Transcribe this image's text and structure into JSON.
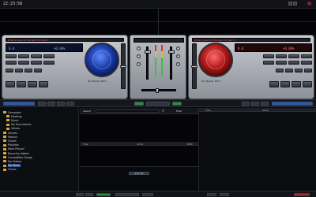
{
  "topbar": {
    "clock": "22:23:58",
    "brand": "DJ"
  },
  "deck_left": {
    "title": "Drag a song on the deck to load it",
    "bpm": "0.0",
    "pitch": "+0.00%",
    "mode_label": "HQ Master Pitch",
    "platter_color": "#1a3aa8"
  },
  "deck_right": {
    "title": "Drag a song on the deck to load it",
    "bpm": "0.0",
    "pitch": "+0.00%",
    "mode_label": "HQ Master Pitch",
    "platter_color": "#b01818"
  },
  "browser": {
    "search_label": "Search",
    "filter_label": "Filter",
    "columns": [
      "Title",
      "Artist",
      "BPM"
    ],
    "right_columns": [
      "Title",
      "Artist"
    ],
    "sidelist_columns": [
      "Title",
      "Artist",
      "Genre"
    ],
    "add_list_label": "Side List",
    "tree": [
      {
        "label": "Computer",
        "selected": false
      },
      {
        "label": "Desktop",
        "selected": false
      },
      {
        "label": "Music",
        "selected": false
      },
      {
        "label": "My Documents",
        "selected": false
      },
      {
        "label": "Videos",
        "selected": false
      },
      {
        "label": "Genres",
        "selected": false
      },
      {
        "label": "History",
        "selected": false
      },
      {
        "label": "iTunes",
        "selected": false
      },
      {
        "label": "Playlists",
        "selected": false
      },
      {
        "label": "Most Played",
        "selected": false
      },
      {
        "label": "Recently Added",
        "selected": false
      },
      {
        "label": "Compatible Songs",
        "selected": false
      },
      {
        "label": "My Videos",
        "selected": false
      },
      {
        "label": "My Music",
        "selected": true
      },
      {
        "label": "iTunes",
        "selected": false
      }
    ]
  }
}
